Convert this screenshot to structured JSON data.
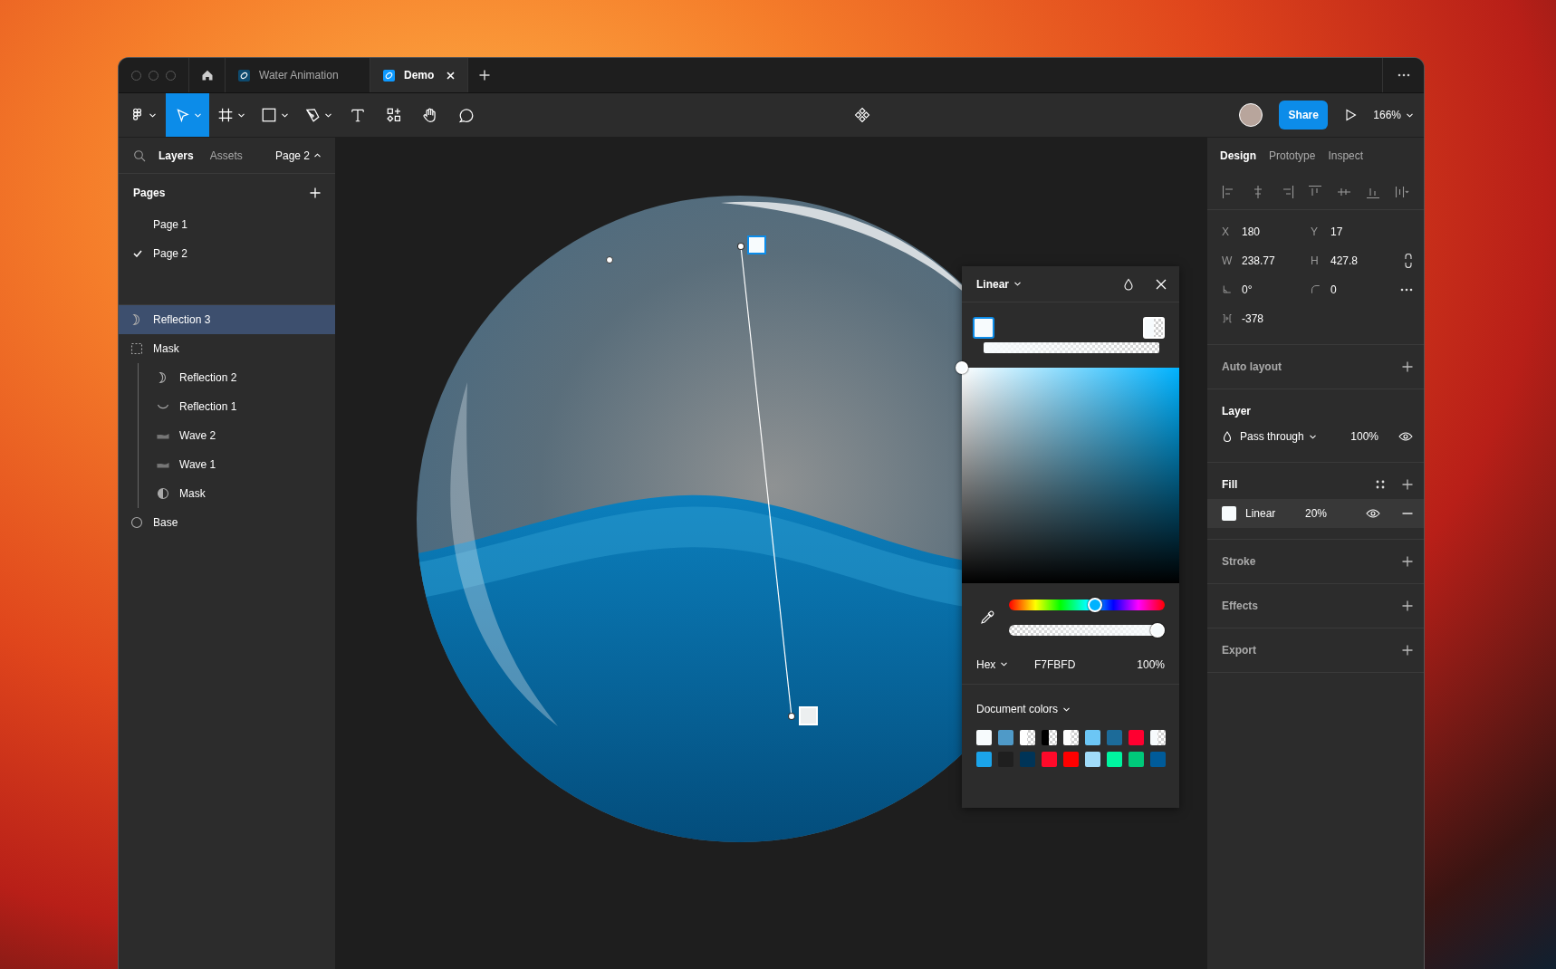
{
  "window": {
    "tabs": [
      {
        "label": "Water Animation",
        "selected": false
      },
      {
        "label": "Demo",
        "selected": true
      }
    ]
  },
  "toolbar": {
    "tools": [
      {
        "kind": "main-menu",
        "selected": false,
        "dropdown": true
      },
      {
        "kind": "move",
        "selected": true,
        "dropdown": true
      },
      {
        "kind": "frame",
        "selected": false,
        "dropdown": true
      },
      {
        "kind": "shape",
        "selected": false,
        "dropdown": true
      },
      {
        "kind": "pen",
        "selected": false,
        "dropdown": true
      },
      {
        "kind": "text",
        "selected": false,
        "dropdown": false
      },
      {
        "kind": "resources",
        "selected": false,
        "dropdown": false
      },
      {
        "kind": "hand",
        "selected": false,
        "dropdown": false
      },
      {
        "kind": "comment",
        "selected": false,
        "dropdown": false
      }
    ],
    "share": "Share",
    "zoom": "166%"
  },
  "left_panel": {
    "tabs": [
      {
        "label": "Layers",
        "selected": true
      },
      {
        "label": "Assets",
        "selected": false
      }
    ],
    "current_page": "Page 2",
    "pages": {
      "title": "Pages",
      "items": [
        {
          "label": "Page 1",
          "selected": false
        },
        {
          "label": "Page 2",
          "selected": true
        }
      ]
    },
    "layers": [
      {
        "name": "Reflection 3",
        "kind": "crescent",
        "selected": true
      },
      {
        "name": "Mask",
        "kind": "frame",
        "selected": false,
        "children": [
          {
            "name": "Reflection 2",
            "kind": "crescent",
            "selected": false
          },
          {
            "name": "Reflection 1",
            "kind": "arc",
            "selected": false
          },
          {
            "name": "Wave 2",
            "kind": "wave",
            "selected": false
          },
          {
            "name": "Wave 1",
            "kind": "wave",
            "selected": false
          },
          {
            "name": "Mask",
            "kind": "mask",
            "selected": false
          }
        ]
      },
      {
        "name": "Base",
        "kind": "ellipse",
        "selected": false
      }
    ]
  },
  "right_panel": {
    "tabs": [
      {
        "label": "Design",
        "selected": true
      },
      {
        "label": "Prototype",
        "selected": false
      },
      {
        "label": "Inspect",
        "selected": false
      }
    ],
    "properties": [
      {
        "kind": "text-label",
        "label": "X",
        "value": "180"
      },
      {
        "kind": "text-label",
        "label": "Y",
        "value": "17"
      },
      {
        "kind": "text-label",
        "label": "W",
        "value": "238.77"
      },
      {
        "kind": "text-label",
        "label": "H",
        "value": "427.8"
      },
      {
        "kind": "rotation",
        "value": "0°"
      },
      {
        "kind": "radius",
        "value": "0"
      },
      {
        "kind": "spacing",
        "value": "-378"
      }
    ],
    "sections": [
      {
        "kind": "add",
        "title": "Auto layout",
        "active": false
      },
      {
        "kind": "layer",
        "title": "Layer",
        "active": true,
        "blend_mode": "Pass through",
        "opacity": "100%",
        "visible": true
      },
      {
        "kind": "fill",
        "title": "Fill",
        "active": true,
        "fills": [
          {
            "type": "Linear",
            "opacity": "20%",
            "visible": true
          }
        ]
      },
      {
        "kind": "add",
        "title": "Stroke",
        "active": false
      },
      {
        "kind": "add",
        "title": "Effects",
        "active": false
      },
      {
        "kind": "add",
        "title": "Export",
        "active": false
      }
    ]
  },
  "color_picker": {
    "fill_type": "Linear",
    "stops": [
      {
        "selected": true
      },
      {
        "selected": false
      }
    ],
    "hue": {
      "level": 0.55
    },
    "alpha": {
      "level": 1
    },
    "format": "Hex",
    "hex": "F7FBFD",
    "opacity": "100%",
    "document_colors": {
      "title": "Document colors",
      "swatches": [
        {
          "color": "#f7fbfd",
          "kind": "solid"
        },
        {
          "color": "#4f9ac8",
          "kind": "solid"
        },
        {
          "color": "#ffffff",
          "kind": "half-transparent"
        },
        {
          "color": "#000000",
          "kind": "half-transparent"
        },
        {
          "color": "#ffffff",
          "kind": "half-transparent"
        },
        {
          "color": "#6cc6f5",
          "kind": "solid"
        },
        {
          "color": "#1c6b99",
          "kind": "solid"
        },
        {
          "color": "#ff0030",
          "kind": "solid"
        },
        {
          "color": "#f7fbfd",
          "kind": "half-transparent"
        },
        {
          "color": "#1ba4ea",
          "kind": "solid"
        },
        {
          "color": "#1f1f1f",
          "kind": "solid"
        },
        {
          "color": "#003457",
          "kind": "solid"
        },
        {
          "color": "#ff0a2a",
          "kind": "solid"
        },
        {
          "color": "#ff0000",
          "kind": "solid"
        },
        {
          "color": "#a1dcfa",
          "kind": "solid"
        },
        {
          "color": "#00f5a0",
          "kind": "solid"
        },
        {
          "color": "#00c97a",
          "kind": "solid"
        },
        {
          "color": "#005b99",
          "kind": "solid"
        }
      ]
    }
  }
}
